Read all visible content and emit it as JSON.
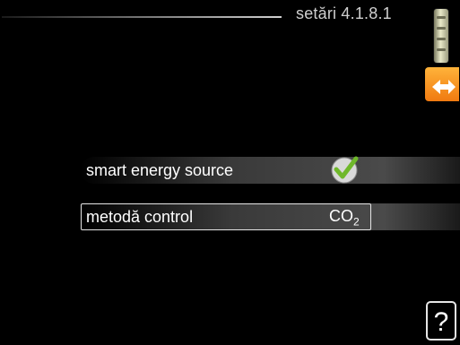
{
  "header": {
    "title": "setări 4.1.8.1"
  },
  "menu": {
    "rows": [
      {
        "label": "smart energy source",
        "value_icon": "checkmark-icon",
        "checked": true
      },
      {
        "label": "metodă control",
        "value": "CO",
        "value_sub": "2",
        "selected": true
      }
    ]
  },
  "side_icons": [
    "scroll-indicator",
    "status-icon"
  ],
  "help": {
    "label": "?"
  },
  "colors": {
    "background": "#000000",
    "accent": "#f39a1e",
    "check": "#6fb82a"
  }
}
